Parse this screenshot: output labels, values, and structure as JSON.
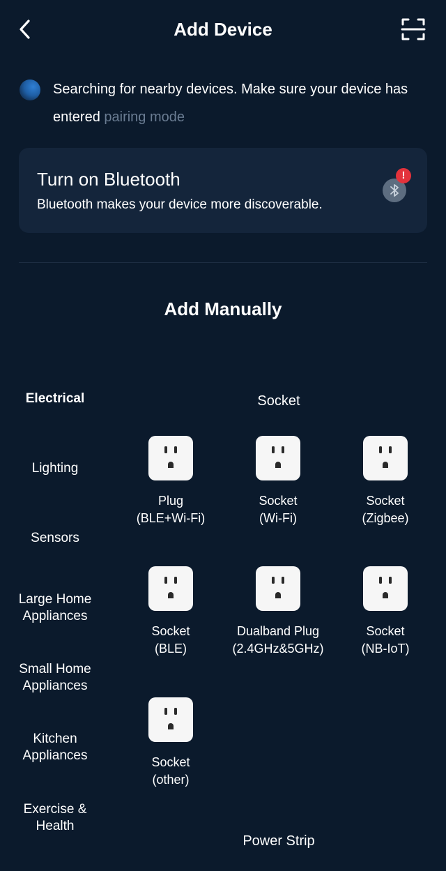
{
  "header": {
    "title": "Add Device"
  },
  "searching": {
    "text": "Searching for nearby devices. Make sure your device has entered ",
    "link": "pairing mode"
  },
  "bluetooth_card": {
    "title": "Turn on Bluetooth",
    "subtitle": "Bluetooth makes your device more discoverable.",
    "alert_badge": "!"
  },
  "manual": {
    "title": "Add Manually"
  },
  "categories": [
    {
      "label": "Electrical",
      "active": true
    },
    {
      "label": "Lighting"
    },
    {
      "label": "Sensors"
    },
    {
      "label": "Large Home Appliances"
    },
    {
      "label": "Small Home Appliances"
    },
    {
      "label": "Kitchen Appliances"
    },
    {
      "label": "Exercise & Health"
    }
  ],
  "groups": [
    {
      "title": "Socket",
      "devices": [
        {
          "line1": "Plug",
          "line2": "(BLE+Wi-Fi)",
          "icon": "socket-icon"
        },
        {
          "line1": "Socket",
          "line2": "(Wi-Fi)",
          "icon": "socket-icon"
        },
        {
          "line1": "Socket",
          "line2": "(Zigbee)",
          "icon": "socket-icon"
        },
        {
          "line1": "Socket",
          "line2": "(BLE)",
          "icon": "socket-icon"
        },
        {
          "line1": "Dualband Plug",
          "line2": "(2.4GHz&5GHz)",
          "icon": "socket-icon"
        },
        {
          "line1": "Socket",
          "line2": "(NB-IoT)",
          "icon": "socket-icon"
        },
        {
          "line1": "Socket",
          "line2": "(other)",
          "icon": "socket-icon"
        }
      ]
    },
    {
      "title": "Power Strip",
      "devices": []
    }
  ],
  "colors": {
    "background": "#0b1a2c",
    "card": "#14253b",
    "link": "#6a7c92",
    "alert": "#e3323b"
  }
}
